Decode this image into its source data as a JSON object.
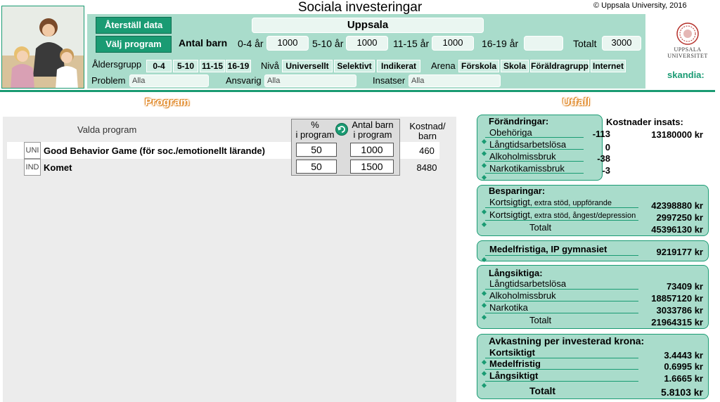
{
  "header": {
    "title": "Sociala investeringar",
    "copyright": "© Uppsala University, 2016",
    "municipality": "Uppsala",
    "reset_button": "Återställ data",
    "choose_program_button": "Välj program"
  },
  "children": {
    "label": "Antal barn",
    "groups": [
      {
        "label": "0-4 år",
        "value": "1000"
      },
      {
        "label": "5-10 år",
        "value": "1000"
      },
      {
        "label": "11-15 år",
        "value": "1000"
      },
      {
        "label": "16-19 år",
        "value": ""
      }
    ],
    "total_label": "Totalt",
    "total_value": "3000"
  },
  "filters": {
    "age_label": "Åldersgrupp",
    "age_options": [
      "0-4",
      "5-10",
      "11-15",
      "16-19"
    ],
    "level_label": "Nivå",
    "level_options": [
      "Universellt",
      "Selektivt",
      "Indikerat"
    ],
    "arena_label": "Arena",
    "arena_options": [
      "Förskola",
      "Skola",
      "Föräldragrupp",
      "Internet"
    ],
    "problem_label": "Problem",
    "problem_value": "Alla",
    "responsible_label": "Ansvarig",
    "responsible_value": "Alla",
    "efforts_label": "Insatser",
    "efforts_value": "Alla"
  },
  "logos": {
    "uppsala_line1": "UPPSALA",
    "uppsala_line2": "UNIVERSITET",
    "skandia": "skandia"
  },
  "program_section": {
    "title": "Program",
    "selected_label": "Valda program",
    "col_percent_line1": "%",
    "col_percent_line2": "i program",
    "col_children_line1": "Antal barn",
    "col_children_line2": "i program",
    "col_cost_line1": "Kostnad/",
    "col_cost_line2": "barn",
    "rows": [
      {
        "tag": "UNI",
        "name": "Good Behavior Game (för soc./emotionellt lärande)",
        "bold": true,
        "percent": "50",
        "children": "1000",
        "cost": "460"
      },
      {
        "tag": "IND",
        "name": "Komet",
        "bold": true,
        "percent": "50",
        "children": "1500",
        "cost": "8480"
      }
    ]
  },
  "outcome_section": {
    "title": "Utfall",
    "changes": {
      "title": "Förändringar:",
      "rows": [
        {
          "label": "Obehöriga",
          "value": "-113"
        },
        {
          "label": "Långtidsarbetslösa",
          "value": "0"
        },
        {
          "label": "Alkoholmissbruk",
          "value": "-38"
        },
        {
          "label": "Narkotikamissbruk",
          "value": "-3"
        }
      ]
    },
    "intervention_cost": {
      "label": "Kostnader insats:",
      "value": "13180000 kr"
    },
    "savings": {
      "title": "Besparingar:",
      "rows": [
        {
          "label_main": "Kortsigtigt",
          "label_sub": ", extra stöd, uppförande",
          "value": "42398880 kr"
        },
        {
          "label_main": "Kortsigtigt",
          "label_sub": ", extra stöd, ångest/depression",
          "value": "2997250 kr"
        }
      ],
      "total_label": "Totalt",
      "total_value": "45396130 kr"
    },
    "medium": {
      "label": "Medelfristiga, IP gymnasiet",
      "value": "9219177 kr"
    },
    "longterm": {
      "title": "Långsiktiga:",
      "rows": [
        {
          "label": "Långtidsarbetslösa",
          "value": "73409 kr"
        },
        {
          "label": "Alkoholmissbruk",
          "value": "18857120 kr"
        },
        {
          "label": "Narkotika",
          "value": "3033786 kr"
        }
      ],
      "total_label": "Totalt",
      "total_value": "21964315 kr"
    },
    "return": {
      "title": "Avkastning per investerad krona:",
      "rows": [
        {
          "label": "Kortsiktigt",
          "value": "3.4443 kr"
        },
        {
          "label": "Medelfristig",
          "value": "0.6995 kr"
        },
        {
          "label": "Långsiktigt",
          "value": "1.6665 kr"
        }
      ],
      "total_label": "Totalt",
      "total_value": "5.8103 kr"
    }
  },
  "colors": {
    "green": "#1a9b73",
    "panel": "#a9dccb",
    "orange": "#e0892a"
  }
}
